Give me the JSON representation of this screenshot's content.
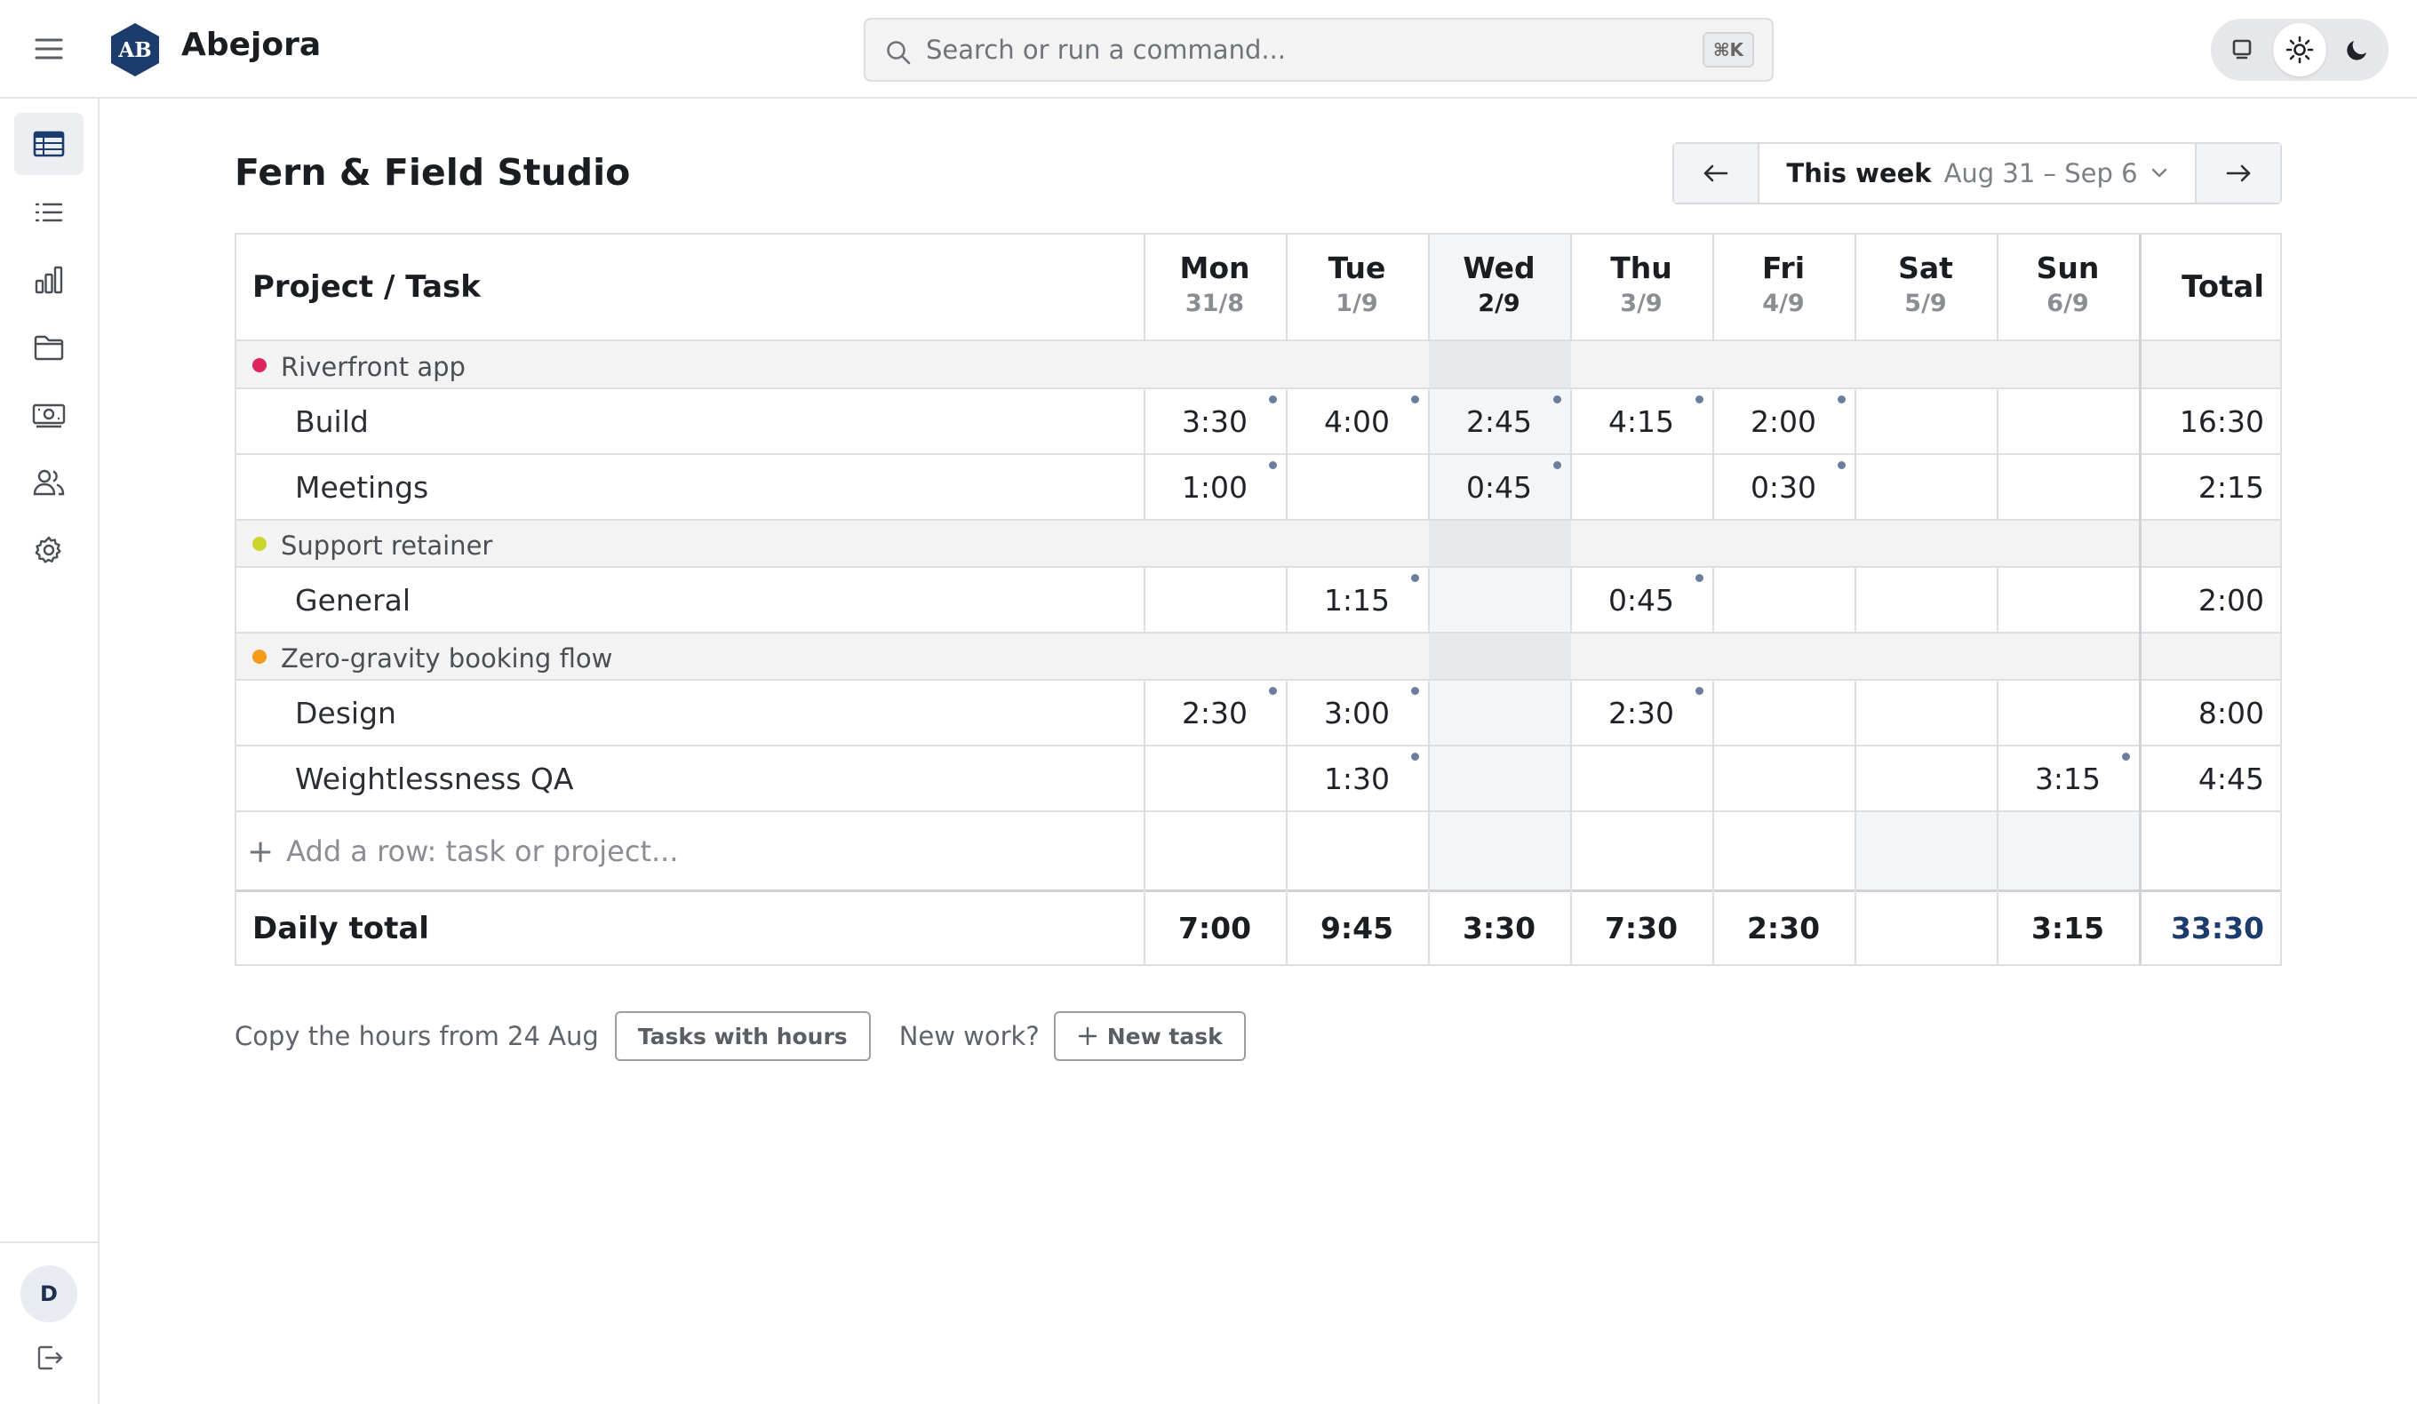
{
  "app": {
    "logo_initials": "AB",
    "name": "Abejora"
  },
  "search": {
    "placeholder": "Search or run a command...",
    "shortcut": "⌘K"
  },
  "theme": {
    "options": [
      "monitor-icon",
      "sun-icon",
      "moon-icon"
    ],
    "selected": "light"
  },
  "sidebar": {
    "items": [
      {
        "icon": "timesheet-grid-icon",
        "active": true
      },
      {
        "icon": "list-icon",
        "active": false
      },
      {
        "icon": "bar-chart-icon",
        "active": false
      },
      {
        "icon": "folder-icon",
        "active": false
      },
      {
        "icon": "money-icon",
        "active": false
      },
      {
        "icon": "users-icon",
        "active": false
      },
      {
        "icon": "settings-icon",
        "active": false
      }
    ],
    "avatar_initial": "D",
    "logout_icon": "logout-icon"
  },
  "page": {
    "title": "Fern & Field Studio"
  },
  "week": {
    "label": "This week",
    "range": "Aug 31 – Sep 6"
  },
  "table": {
    "header_task": "Project / Task",
    "header_total": "Total",
    "days": [
      {
        "day": "Mon",
        "date": "31/8"
      },
      {
        "day": "Tue",
        "date": "1/9"
      },
      {
        "day": "Wed",
        "date": "2/9",
        "today": true
      },
      {
        "day": "Thu",
        "date": "3/9"
      },
      {
        "day": "Fri",
        "date": "4/9"
      },
      {
        "day": "Sat",
        "date": "5/9"
      },
      {
        "day": "Sun",
        "date": "6/9"
      }
    ],
    "projects": [
      {
        "name": "Riverfront app",
        "color": "#e0245e",
        "tasks": [
          {
            "name": "Build",
            "hours": [
              "3:30",
              "4:00",
              "2:45",
              "4:15",
              "2:00",
              "",
              ""
            ],
            "total": "16:30"
          },
          {
            "name": "Meetings",
            "hours": [
              "1:00",
              "",
              "0:45",
              "",
              "0:30",
              "",
              ""
            ],
            "total": "2:15"
          }
        ]
      },
      {
        "name": "Support retainer",
        "color": "#c9d62b",
        "tasks": [
          {
            "name": "General",
            "hours": [
              "",
              "1:15",
              "",
              "0:45",
              "",
              "",
              ""
            ],
            "total": "2:00"
          }
        ]
      },
      {
        "name": "Zero-gravity booking flow",
        "color": "#f59a1b",
        "tasks": [
          {
            "name": "Design",
            "hours": [
              "2:30",
              "3:00",
              "",
              "2:30",
              "",
              "",
              ""
            ],
            "total": "8:00"
          },
          {
            "name": "Weightlessness QA",
            "hours": [
              "",
              "1:30",
              "",
              "",
              "",
              "",
              "3:15"
            ],
            "total": "4:45"
          }
        ]
      }
    ],
    "add_row_placeholder": "Add a row: task or project...",
    "footer_label": "Daily total",
    "daily_totals": [
      "7:00",
      "9:45",
      "3:30",
      "7:30",
      "2:30",
      "",
      "3:15"
    ],
    "grand_total": "33:30"
  },
  "below": {
    "copy_text": "Copy the hours from 24 Aug",
    "copy_button": "Tasks with hours",
    "new_work_text": "New work?",
    "new_task_button": "New task"
  }
}
